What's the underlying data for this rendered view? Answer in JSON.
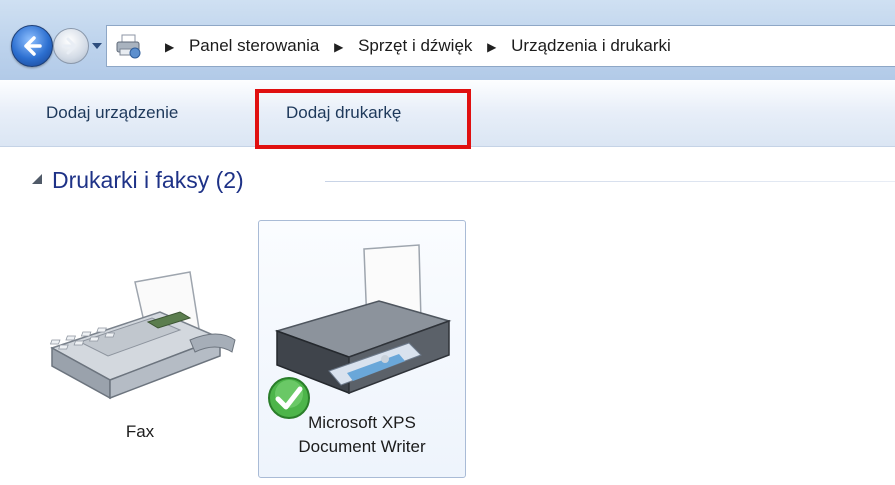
{
  "navigation": {
    "back_icon": "back-arrow-icon",
    "forward_icon": "forward-arrow-icon",
    "history_icon": "dropdown-icon"
  },
  "breadcrumb": {
    "location_icon": "devices-and-printers-icon",
    "items": [
      "Panel sterowania",
      "Sprzęt i dźwięk",
      "Urządzenia i drukarki"
    ],
    "separator_icon": "chevron-right-icon"
  },
  "toolbar": {
    "add_device_label": "Dodaj urządzenie",
    "add_printer_label": "Dodaj drukarkę",
    "highlight_color": "#e01010"
  },
  "group": {
    "title": "Drukarki i faksy (2)"
  },
  "devices": [
    {
      "label": "Fax",
      "icon": "fax-icon"
    },
    {
      "label_line1": "Microsoft XPS",
      "label_line2": "Document Writer",
      "icon": "printer-icon",
      "status_icon": "default-check-icon"
    }
  ]
}
